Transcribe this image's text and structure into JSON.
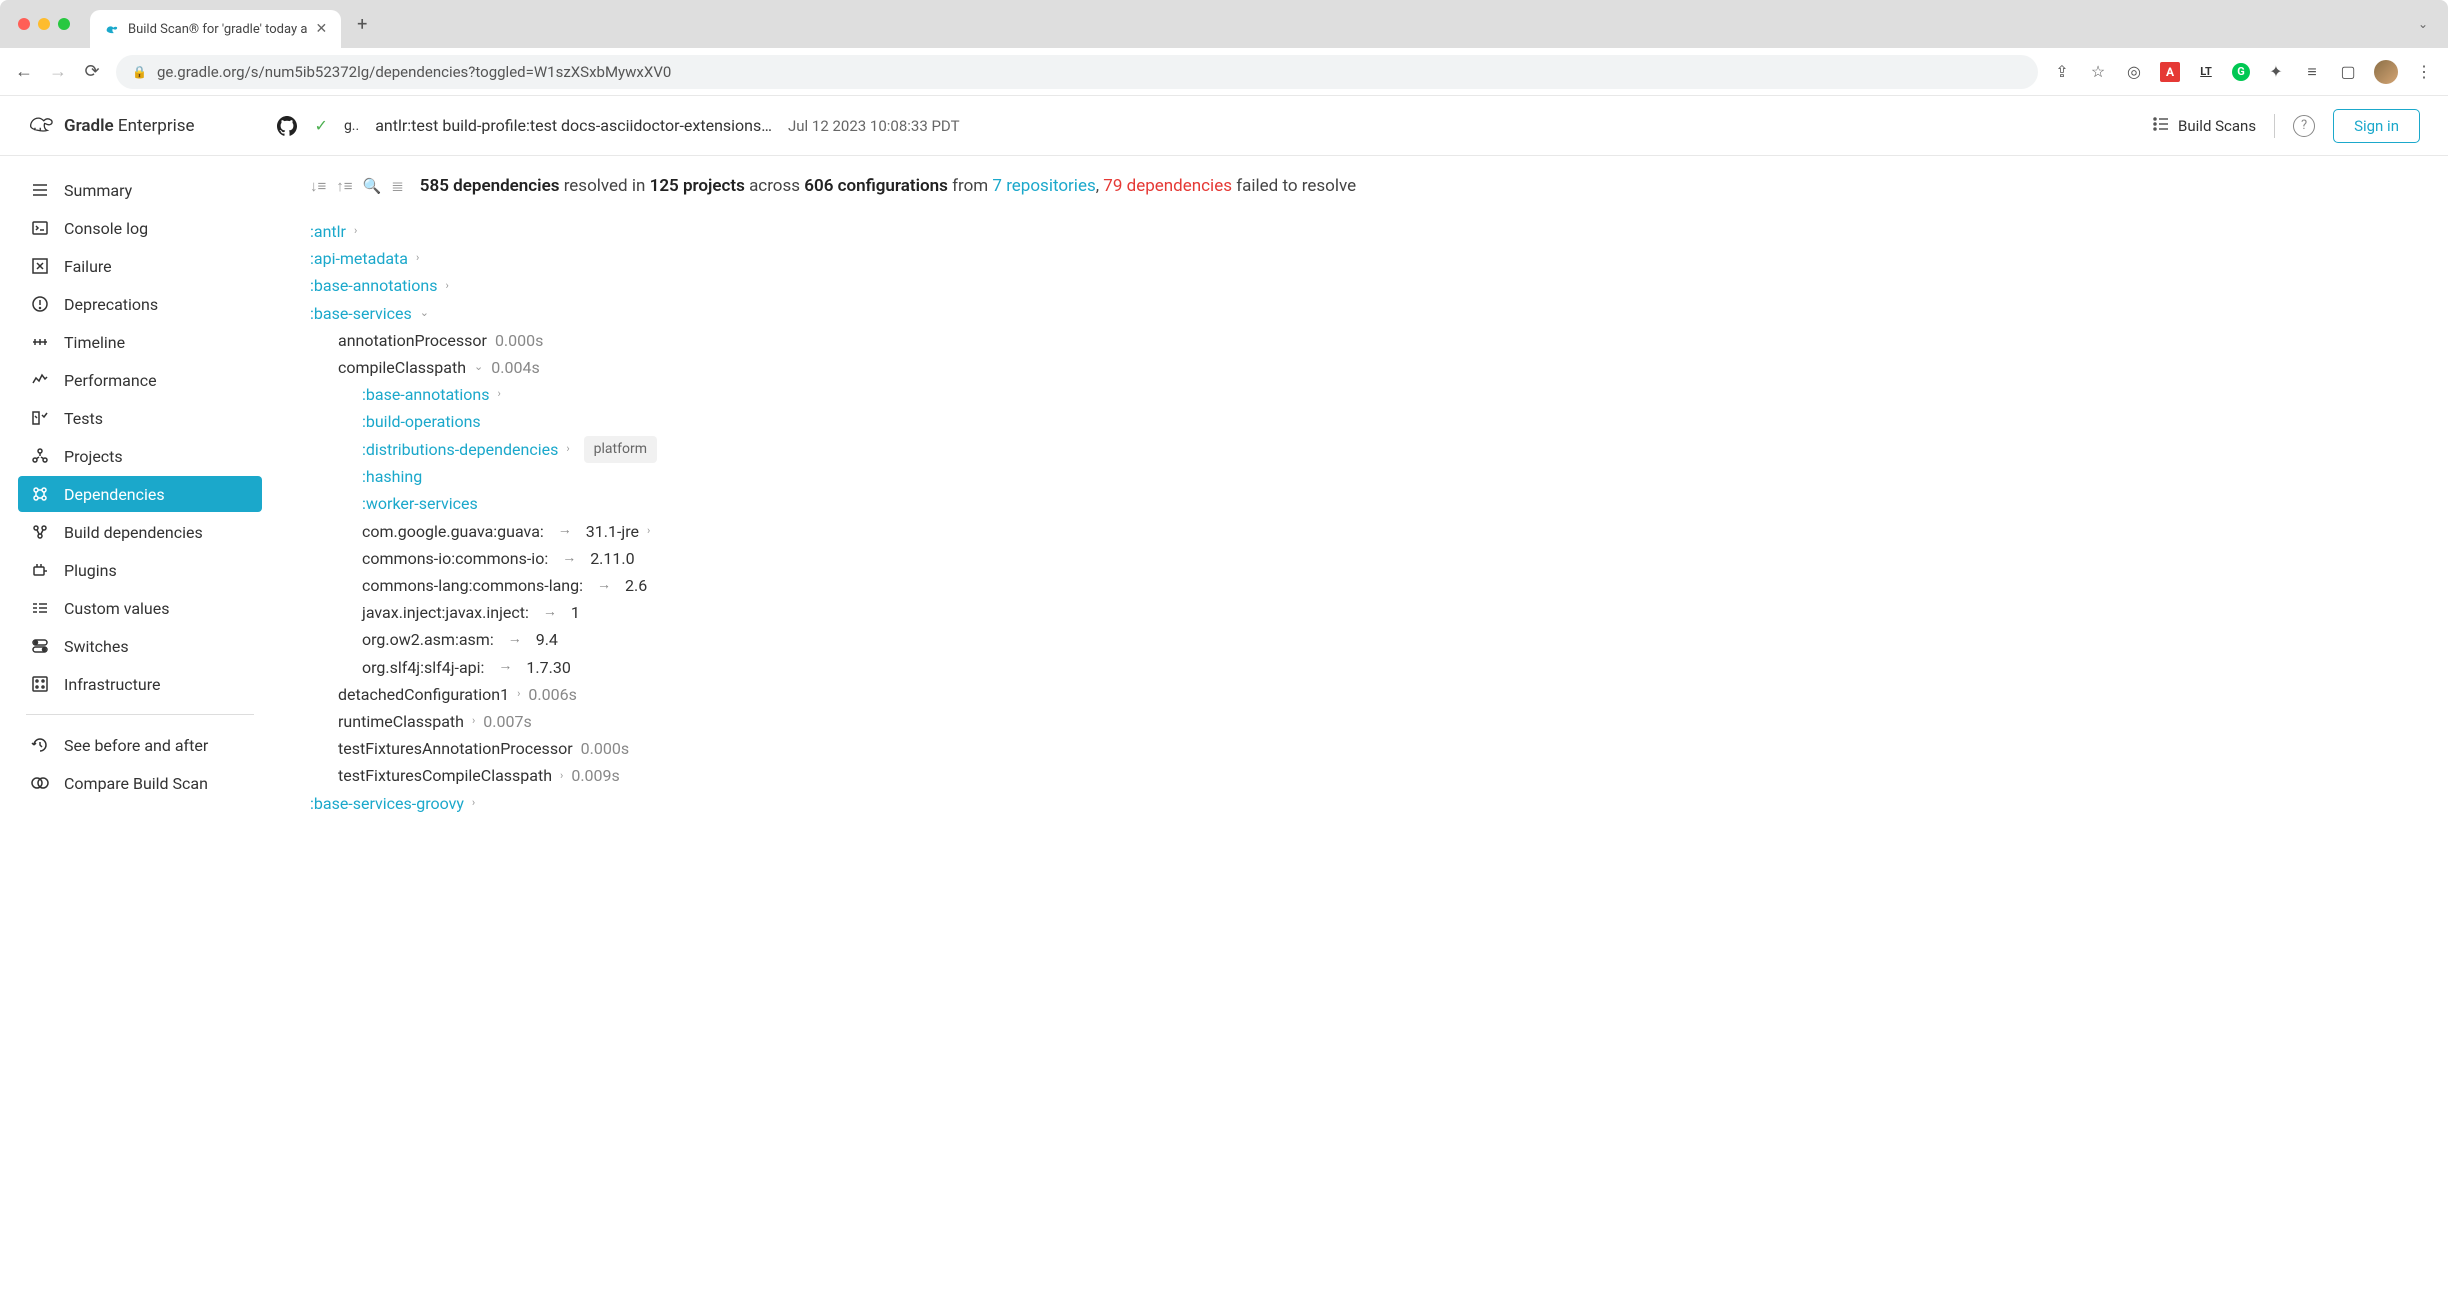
{
  "browser": {
    "tab_title": "Build Scan® for 'gradle' today a",
    "url": "ge.gradle.org/s/num5ib52372lg/dependencies?toggled=W1szXSxbMywxXV0"
  },
  "header": {
    "logo_bold": "Gradle",
    "logo_rest": "Enterprise",
    "status_prefix": "g..",
    "build_title": "antlr:test build-profile:test docs-asciidoctor-extensions…",
    "timestamp": "Jul 12 2023 10:08:33 PDT",
    "scans_label": "Build Scans",
    "signin_label": "Sign in"
  },
  "sidebar": {
    "items": [
      "Summary",
      "Console log",
      "Failure",
      "Deprecations",
      "Timeline",
      "Performance",
      "Tests",
      "Projects",
      "Dependencies",
      "Build dependencies",
      "Plugins",
      "Custom values",
      "Switches",
      "Infrastructure"
    ],
    "footer": [
      "See before and after",
      "Compare Build Scan"
    ]
  },
  "summary": {
    "deps_count": "585 dependencies",
    "resolved_in": "resolved in",
    "projects_count": "125 projects",
    "across": "across",
    "configs_count": "606 configurations",
    "from": "from",
    "repos_link": "7 repositories",
    "comma": ", ",
    "failed_link": "79 dependencies",
    "failed_rest": "failed to resolve"
  },
  "tree": {
    "antlr": ":antlr",
    "api_metadata": ":api-metadata",
    "base_annotations": ":base-annotations",
    "base_services": ":base-services",
    "bs_children": {
      "annotationProcessor": {
        "name": "annotationProcessor",
        "time": "0.000s"
      },
      "compileClasspath": {
        "name": "compileClasspath",
        "time": "0.004s"
      },
      "cc_children": {
        "base_annotations": ":base-annotations",
        "build_operations": ":build-operations",
        "dist_deps": ":distributions-dependencies",
        "dist_badge": "platform",
        "hashing": ":hashing",
        "worker_services": ":worker-services",
        "guava": {
          "artifact": "com.google.guava:guava:",
          "version": "31.1-jre"
        },
        "commons_io": {
          "artifact": "commons-io:commons-io:",
          "version": "2.11.0"
        },
        "commons_lang": {
          "artifact": "commons-lang:commons-lang:",
          "version": "2.6"
        },
        "javax_inject": {
          "artifact": "javax.inject:javax.inject:",
          "version": "1"
        },
        "asm": {
          "artifact": "org.ow2.asm:asm:",
          "version": "9.4"
        },
        "slf4j": {
          "artifact": "org.slf4j:slf4j-api:",
          "version": "1.7.30"
        }
      },
      "detached": {
        "name": "detachedConfiguration1",
        "time": "0.006s"
      },
      "runtime": {
        "name": "runtimeClasspath",
        "time": "0.007s"
      },
      "testFxAnno": {
        "name": "testFixturesAnnotationProcessor",
        "time": "0.000s"
      },
      "testFxCompile": {
        "name": "testFixturesCompileClasspath",
        "time": "0.009s"
      }
    },
    "base_services_groovy": ":base-services-groovy"
  }
}
